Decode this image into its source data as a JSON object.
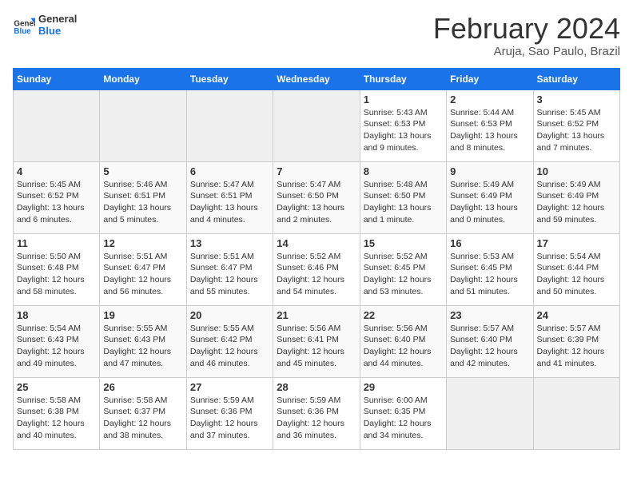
{
  "logo": {
    "text_general": "General",
    "text_blue": "Blue"
  },
  "title": "February 2024",
  "subtitle": "Aruja, Sao Paulo, Brazil",
  "days_of_week": [
    "Sunday",
    "Monday",
    "Tuesday",
    "Wednesday",
    "Thursday",
    "Friday",
    "Saturday"
  ],
  "weeks": [
    [
      {
        "day": "",
        "info": "",
        "empty": true
      },
      {
        "day": "",
        "info": "",
        "empty": true
      },
      {
        "day": "",
        "info": "",
        "empty": true
      },
      {
        "day": "",
        "info": "",
        "empty": true
      },
      {
        "day": "1",
        "info": "Sunrise: 5:43 AM\nSunset: 6:53 PM\nDaylight: 13 hours\nand 9 minutes."
      },
      {
        "day": "2",
        "info": "Sunrise: 5:44 AM\nSunset: 6:53 PM\nDaylight: 13 hours\nand 8 minutes."
      },
      {
        "day": "3",
        "info": "Sunrise: 5:45 AM\nSunset: 6:52 PM\nDaylight: 13 hours\nand 7 minutes."
      }
    ],
    [
      {
        "day": "4",
        "info": "Sunrise: 5:45 AM\nSunset: 6:52 PM\nDaylight: 13 hours\nand 6 minutes."
      },
      {
        "day": "5",
        "info": "Sunrise: 5:46 AM\nSunset: 6:51 PM\nDaylight: 13 hours\nand 5 minutes."
      },
      {
        "day": "6",
        "info": "Sunrise: 5:47 AM\nSunset: 6:51 PM\nDaylight: 13 hours\nand 4 minutes."
      },
      {
        "day": "7",
        "info": "Sunrise: 5:47 AM\nSunset: 6:50 PM\nDaylight: 13 hours\nand 2 minutes."
      },
      {
        "day": "8",
        "info": "Sunrise: 5:48 AM\nSunset: 6:50 PM\nDaylight: 13 hours\nand 1 minute."
      },
      {
        "day": "9",
        "info": "Sunrise: 5:49 AM\nSunset: 6:49 PM\nDaylight: 13 hours\nand 0 minutes."
      },
      {
        "day": "10",
        "info": "Sunrise: 5:49 AM\nSunset: 6:49 PM\nDaylight: 12 hours\nand 59 minutes."
      }
    ],
    [
      {
        "day": "11",
        "info": "Sunrise: 5:50 AM\nSunset: 6:48 PM\nDaylight: 12 hours\nand 58 minutes."
      },
      {
        "day": "12",
        "info": "Sunrise: 5:51 AM\nSunset: 6:47 PM\nDaylight: 12 hours\nand 56 minutes."
      },
      {
        "day": "13",
        "info": "Sunrise: 5:51 AM\nSunset: 6:47 PM\nDaylight: 12 hours\nand 55 minutes."
      },
      {
        "day": "14",
        "info": "Sunrise: 5:52 AM\nSunset: 6:46 PM\nDaylight: 12 hours\nand 54 minutes."
      },
      {
        "day": "15",
        "info": "Sunrise: 5:52 AM\nSunset: 6:45 PM\nDaylight: 12 hours\nand 53 minutes."
      },
      {
        "day": "16",
        "info": "Sunrise: 5:53 AM\nSunset: 6:45 PM\nDaylight: 12 hours\nand 51 minutes."
      },
      {
        "day": "17",
        "info": "Sunrise: 5:54 AM\nSunset: 6:44 PM\nDaylight: 12 hours\nand 50 minutes."
      }
    ],
    [
      {
        "day": "18",
        "info": "Sunrise: 5:54 AM\nSunset: 6:43 PM\nDaylight: 12 hours\nand 49 minutes."
      },
      {
        "day": "19",
        "info": "Sunrise: 5:55 AM\nSunset: 6:43 PM\nDaylight: 12 hours\nand 47 minutes."
      },
      {
        "day": "20",
        "info": "Sunrise: 5:55 AM\nSunset: 6:42 PM\nDaylight: 12 hours\nand 46 minutes."
      },
      {
        "day": "21",
        "info": "Sunrise: 5:56 AM\nSunset: 6:41 PM\nDaylight: 12 hours\nand 45 minutes."
      },
      {
        "day": "22",
        "info": "Sunrise: 5:56 AM\nSunset: 6:40 PM\nDaylight: 12 hours\nand 44 minutes."
      },
      {
        "day": "23",
        "info": "Sunrise: 5:57 AM\nSunset: 6:40 PM\nDaylight: 12 hours\nand 42 minutes."
      },
      {
        "day": "24",
        "info": "Sunrise: 5:57 AM\nSunset: 6:39 PM\nDaylight: 12 hours\nand 41 minutes."
      }
    ],
    [
      {
        "day": "25",
        "info": "Sunrise: 5:58 AM\nSunset: 6:38 PM\nDaylight: 12 hours\nand 40 minutes."
      },
      {
        "day": "26",
        "info": "Sunrise: 5:58 AM\nSunset: 6:37 PM\nDaylight: 12 hours\nand 38 minutes."
      },
      {
        "day": "27",
        "info": "Sunrise: 5:59 AM\nSunset: 6:36 PM\nDaylight: 12 hours\nand 37 minutes."
      },
      {
        "day": "28",
        "info": "Sunrise: 5:59 AM\nSunset: 6:36 PM\nDaylight: 12 hours\nand 36 minutes."
      },
      {
        "day": "29",
        "info": "Sunrise: 6:00 AM\nSunset: 6:35 PM\nDaylight: 12 hours\nand 34 minutes."
      },
      {
        "day": "",
        "info": "",
        "empty": true
      },
      {
        "day": "",
        "info": "",
        "empty": true
      }
    ]
  ]
}
